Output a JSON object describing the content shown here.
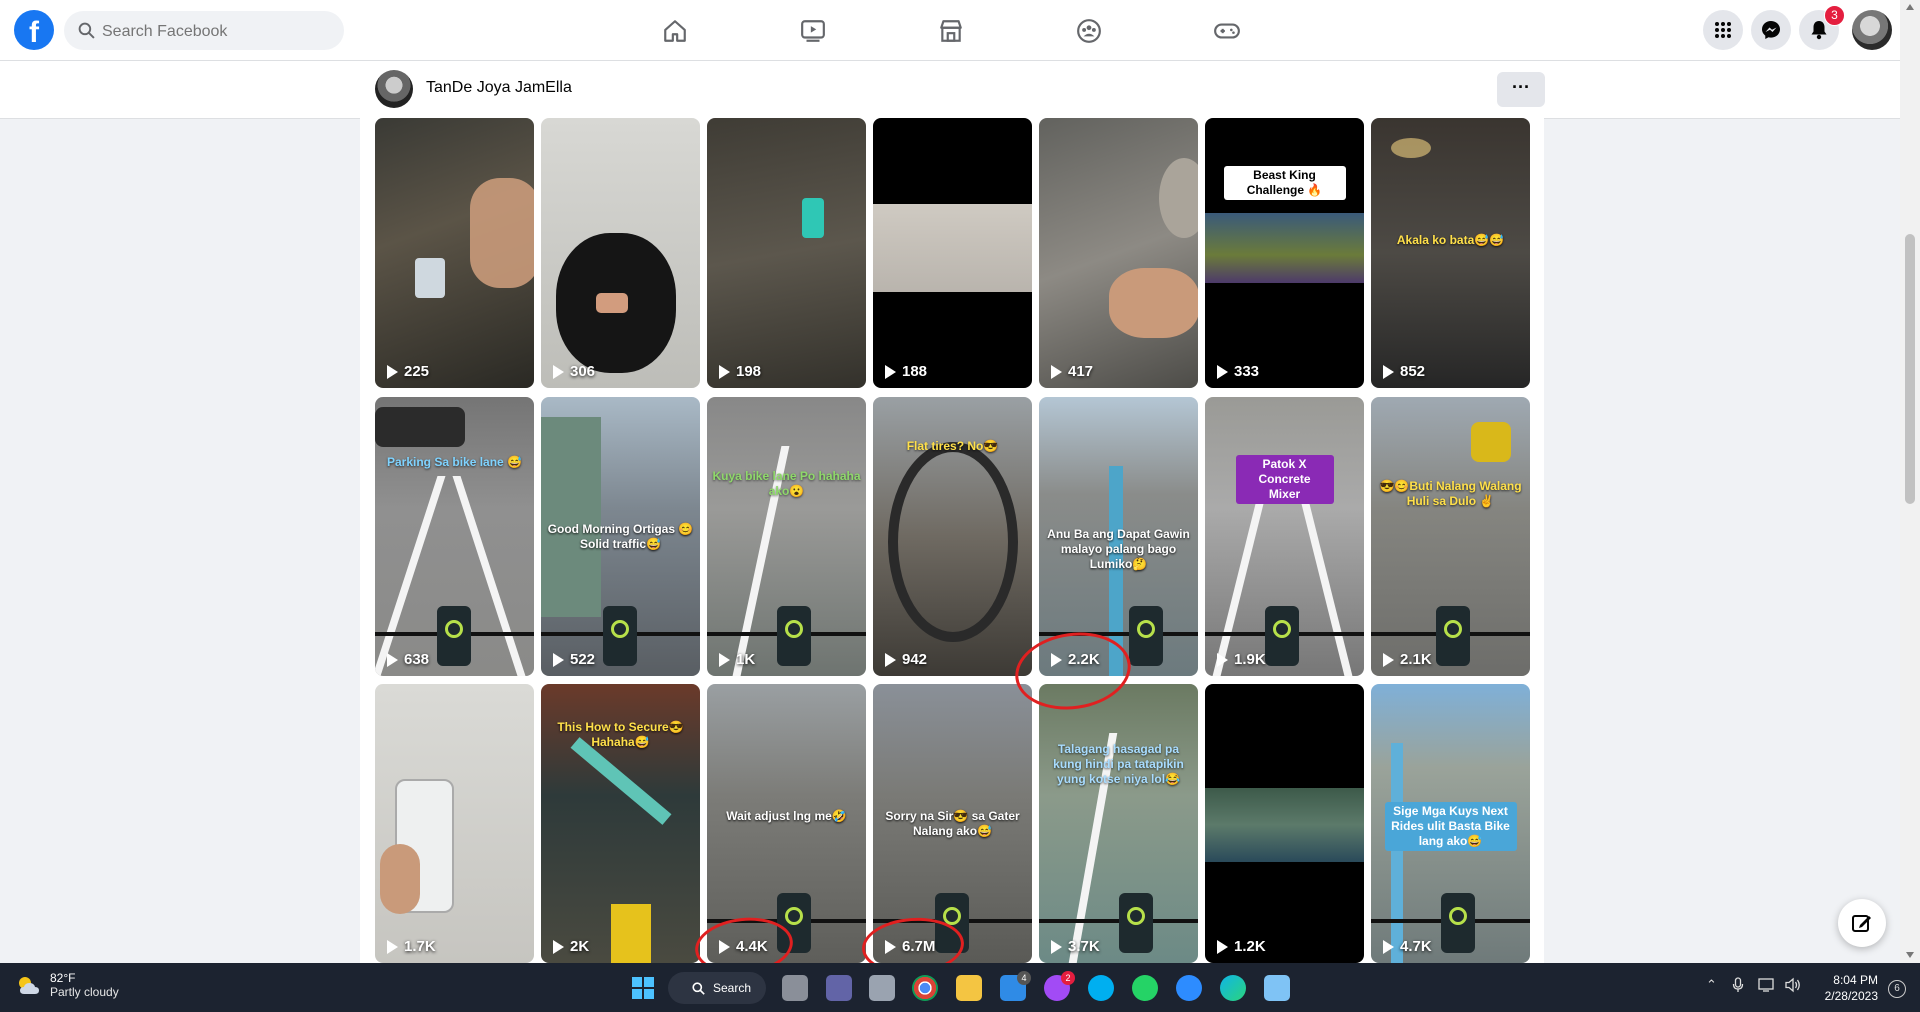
{
  "search": {
    "placeholder": "Search Facebook"
  },
  "notifications": {
    "badge": "3"
  },
  "profile": {
    "name": "TanDe Joya JamElla",
    "more_label": "···"
  },
  "videos": [
    {
      "views": "225",
      "caption": ""
    },
    {
      "views": "306",
      "caption": ""
    },
    {
      "views": "198",
      "caption": ""
    },
    {
      "views": "188",
      "caption": ""
    },
    {
      "views": "417",
      "caption": ""
    },
    {
      "views": "333",
      "caption": "Beast King Challenge 🔥"
    },
    {
      "views": "852",
      "caption": "Akala ko bata😅😅"
    },
    {
      "views": "638",
      "caption": "Parking Sa bike lane 😅"
    },
    {
      "views": "522",
      "caption": "Good Morning Ortigas 😊 Solid traffic😅"
    },
    {
      "views": "1K",
      "caption": "Kuya bike lane Po hahaha ako😮"
    },
    {
      "views": "942",
      "caption": "Flat tires? No😎"
    },
    {
      "views": "2.2K",
      "caption": "Anu Ba ang Dapat Gawin malayo palang bago Lumiko🤔"
    },
    {
      "views": "1.9K",
      "caption": "Patok X Concrete Mixer"
    },
    {
      "views": "2.1K",
      "caption": "😎😊Buti Nalang Walang Huli sa Dulo ✌"
    },
    {
      "views": "1.7K",
      "caption": ""
    },
    {
      "views": "2K",
      "caption": "This How to Secure😎 Hahaha😅"
    },
    {
      "views": "4.4K",
      "caption": "Wait adjust lng me🤣"
    },
    {
      "views": "6.7M",
      "caption": "Sorry na Sir😎 sa Gater Nalang ako😅"
    },
    {
      "views": "3.7K",
      "caption": "Talagang hasagad pa kung hindi pa tatapikin yung kotse niya lol😂"
    },
    {
      "views": "1.2K",
      "caption": ""
    },
    {
      "views": "4.7K",
      "caption": "Sige Mga Kuys Next Rides ulit Basta Bike lang ako😅"
    }
  ],
  "taskbar": {
    "temperature": "82°F",
    "weather_desc": "Partly cloudy",
    "search_label": "Search",
    "mail_badge": "4",
    "messenger_badge": "2",
    "time": "8:04 PM",
    "date": "2/28/2023",
    "notif_count": "6"
  }
}
